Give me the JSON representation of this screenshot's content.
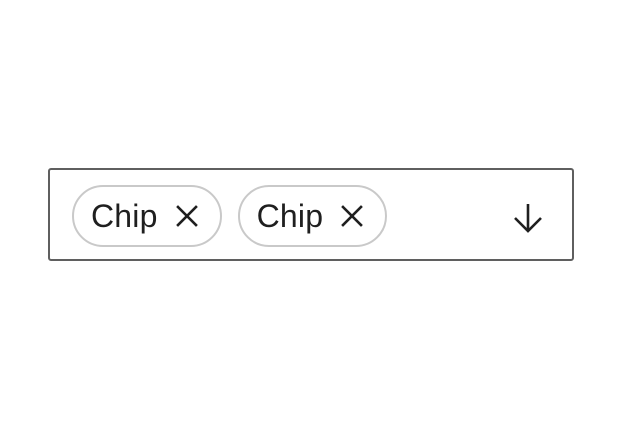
{
  "chips": [
    {
      "label": "Chip",
      "remove_icon": "close-icon"
    },
    {
      "label": "Chip",
      "remove_icon": "close-icon"
    }
  ],
  "dropdown": {
    "icon": "arrow-down-icon"
  },
  "colors": {
    "border": "#5f5f5f",
    "chip_border": "#c9c9c9",
    "text": "#1f1f1f",
    "background": "#ffffff"
  }
}
